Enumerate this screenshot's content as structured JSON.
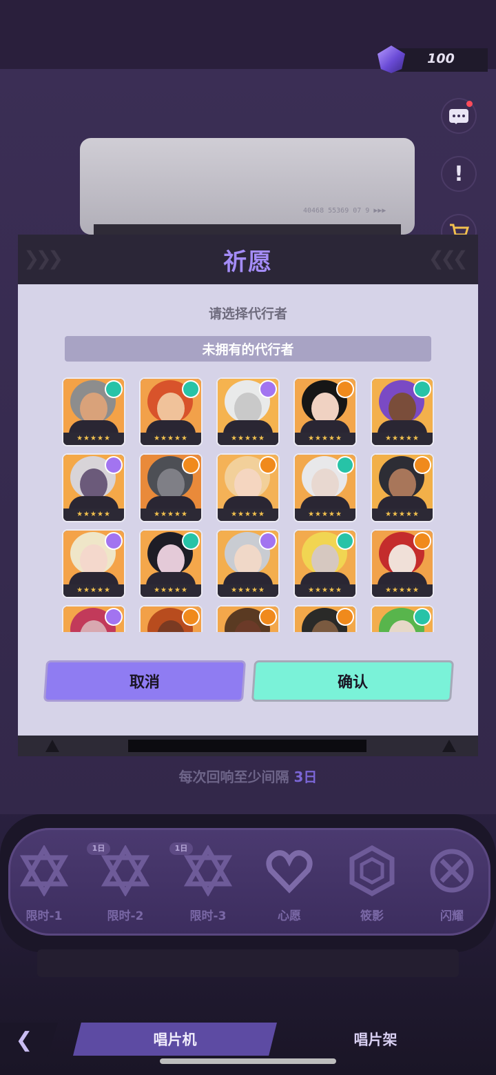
{
  "currency": {
    "value": "100",
    "icon": "crystal-icon"
  },
  "side_buttons": [
    "chat-icon",
    "alert-icon",
    "shop-cart-icon"
  ],
  "background": {
    "serial_text": "40468  55369 07 9  ▶▶▶",
    "interval_note_prefix": "每次回响至少间隔 ",
    "interval_note_value": "3日"
  },
  "modal": {
    "title": "祈愿",
    "subtitle": "请选择代行者",
    "section_label": "未拥有的代行者",
    "cancel_label": "取消",
    "confirm_label": "确认",
    "characters": [
      {
        "bg": "#f4a247",
        "hair": "#8d8d8d",
        "skin": "#d9a27a",
        "elem": "#27c3a7",
        "stars": "★★★★★"
      },
      {
        "bg": "#f2a14a",
        "hair": "#d8532b",
        "skin": "#f0c29a",
        "elem": "#27c3a7",
        "stars": "★★★★★"
      },
      {
        "bg": "#f5b34f",
        "hair": "#e9eaea",
        "skin": "#c9c9c9",
        "elem": "#a274f0",
        "stars": "★★★★★"
      },
      {
        "bg": "#f3a64b",
        "hair": "#161616",
        "skin": "#f0d2c2",
        "elem": "#f08a1c",
        "stars": "★★★★★"
      },
      {
        "bg": "#f3b04c",
        "hair": "#7a4ac4",
        "skin": "#7a4d3a",
        "elem": "#27c3a7",
        "stars": "★★★★★"
      },
      {
        "bg": "#f4a848",
        "hair": "#d8d4d8",
        "skin": "#6b5a7a",
        "elem": "#a274f0",
        "stars": "★★★★★"
      },
      {
        "bg": "#e98a3a",
        "hair": "#4d4f55",
        "skin": "#7f7f86",
        "elem": "#f08a1c",
        "stars": "★★★★★"
      },
      {
        "bg": "#f4b257",
        "hair": "#f2d09a",
        "skin": "#f5d6c0",
        "elem": "#f08a1c",
        "stars": "★★★★★"
      },
      {
        "bg": "#f2a84c",
        "hair": "#e8e8ea",
        "skin": "#e8d8d0",
        "elem": "#27c3a7",
        "stars": "★★★★★"
      },
      {
        "bg": "#f2b049",
        "hair": "#2d2d35",
        "skin": "#a8765a",
        "elem": "#f08a1c",
        "stars": "★★★★★"
      },
      {
        "bg": "#f4a349",
        "hair": "#efe6c8",
        "skin": "#f4d8cc",
        "elem": "#a274f0",
        "stars": "★★★★★"
      },
      {
        "bg": "#f4a74b",
        "hair": "#1d1d26",
        "skin": "#e4cad8",
        "elem": "#27c3a7",
        "stars": "★★★★★"
      },
      {
        "bg": "#f3ae4e",
        "hair": "#c9ccd2",
        "skin": "#f0d8c8",
        "elem": "#a274f0",
        "stars": "★★★★★"
      },
      {
        "bg": "#f2aa4d",
        "hair": "#f1d552",
        "skin": "#d6c8c0",
        "elem": "#27c3a7",
        "stars": "★★★★★"
      },
      {
        "bg": "#f1a24a",
        "hair": "#c42c2c",
        "skin": "#f0e0d8",
        "elem": "#f08a1c",
        "stars": "★★★★★"
      },
      {
        "bg": "#f4a64a",
        "hair": "#c23a5a",
        "skin": "#d8a8b0",
        "elem": "#a274f0",
        "stars": "★★★★★"
      },
      {
        "bg": "#f2a048",
        "hair": "#b84c1e",
        "skin": "#7a3a22",
        "elem": "#f08a1c",
        "stars": "★★★★★"
      },
      {
        "bg": "#f3a74b",
        "hair": "#5a3a22",
        "skin": "#6b3a28",
        "elem": "#f08a1c",
        "stars": "★★★★★"
      },
      {
        "bg": "#f2a84a",
        "hair": "#2a2a28",
        "skin": "#7a5a40",
        "elem": "#f08a1c",
        "stars": "★★★★★"
      },
      {
        "bg": "#f3ad4c",
        "hair": "#58b54c",
        "skin": "#e6d8c8",
        "elem": "#27c3a7",
        "stars": "★★★★★"
      }
    ]
  },
  "banners": [
    {
      "label": "限时-1",
      "tag": "",
      "icon": "star-hexagram-icon"
    },
    {
      "label": "限时-2",
      "tag": "1日",
      "icon": "star-hexagram-icon"
    },
    {
      "label": "限时-3",
      "tag": "1日",
      "icon": "star-hexagram-icon"
    },
    {
      "label": "心愿",
      "tag": "",
      "icon": "heart-knot-icon"
    },
    {
      "label": "筱影",
      "tag": "",
      "icon": "hexagon-icon"
    },
    {
      "label": "闪耀",
      "tag": "",
      "icon": "cross-circle-icon"
    }
  ],
  "nav": {
    "back_icon": "chevron-left-icon",
    "tab_active": "唱片机",
    "tab_other": "唱片架"
  }
}
